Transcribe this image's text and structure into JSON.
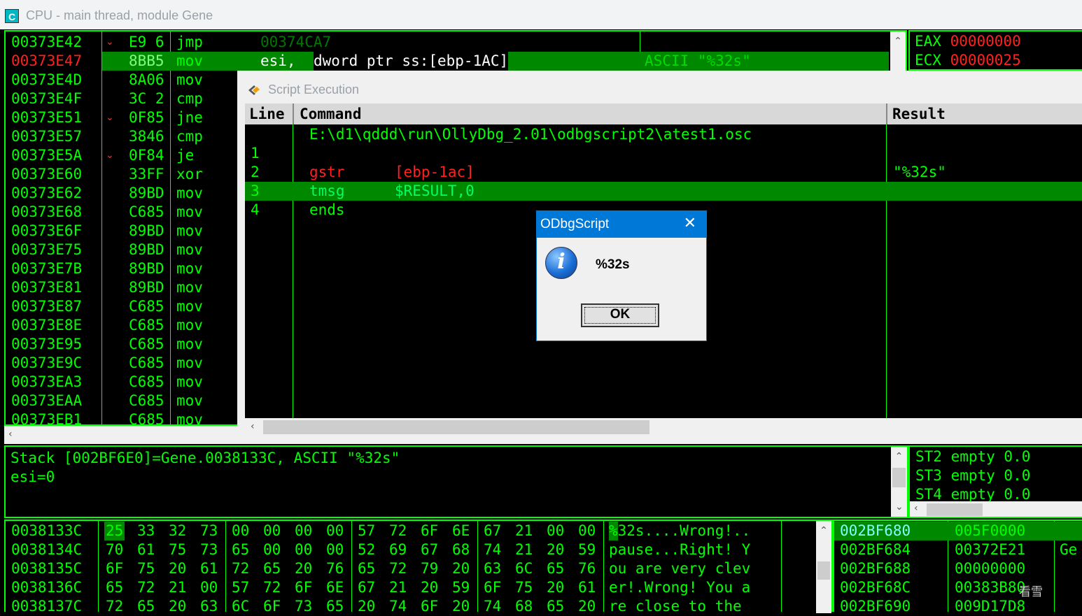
{
  "window": {
    "title": "CPU - main thread, module Gene",
    "logo": "C"
  },
  "disasm": {
    "rows": [
      {
        "addr": "00373E42",
        "hex": "E9 6",
        "mn": "jmp",
        "arrow": "⌄"
      },
      {
        "addr": "00373E47",
        "hex": "8BB5",
        "mn": "mov",
        "arrow": "",
        "selected": true
      },
      {
        "addr": "00373E4D",
        "hex": "8A06",
        "mn": "mov",
        "arrow": ""
      },
      {
        "addr": "00373E4F",
        "hex": "3C 2",
        "mn": "cmp",
        "arrow": ""
      },
      {
        "addr": "00373E51",
        "hex": "0F85",
        "mn": "jne",
        "arrow": "⌄"
      },
      {
        "addr": "00373E57",
        "hex": "3846",
        "mn": "cmp",
        "arrow": ""
      },
      {
        "addr": "00373E5A",
        "hex": "0F84",
        "mn": "je",
        "arrow": "⌄"
      },
      {
        "addr": "00373E60",
        "hex": "33FF",
        "mn": "xor",
        "arrow": ""
      },
      {
        "addr": "00373E62",
        "hex": "89BD",
        "mn": "mov",
        "arrow": ""
      },
      {
        "addr": "00373E68",
        "hex": "C685",
        "mn": "mov",
        "arrow": ""
      },
      {
        "addr": "00373E6F",
        "hex": "89BD",
        "mn": "mov",
        "arrow": ""
      },
      {
        "addr": "00373E75",
        "hex": "89BD",
        "mn": "mov",
        "arrow": ""
      },
      {
        "addr": "00373E7B",
        "hex": "89BD",
        "mn": "mov",
        "arrow": ""
      },
      {
        "addr": "00373E81",
        "hex": "89BD",
        "mn": "mov",
        "arrow": ""
      },
      {
        "addr": "00373E87",
        "hex": "C685",
        "mn": "mov",
        "arrow": ""
      },
      {
        "addr": "00373E8E",
        "hex": "C685",
        "mn": "mov",
        "arrow": ""
      },
      {
        "addr": "00373E95",
        "hex": "C685",
        "mn": "mov",
        "arrow": ""
      },
      {
        "addr": "00373E9C",
        "hex": "C685",
        "mn": "mov",
        "arrow": ""
      },
      {
        "addr": "00373EA3",
        "hex": "C685",
        "mn": "mov",
        "arrow": ""
      },
      {
        "addr": "00373EAA",
        "hex": "C685",
        "mn": "mov",
        "arrow": ""
      },
      {
        "addr": "00373EB1",
        "hex": "C685",
        "mn": "mov",
        "arrow": ""
      }
    ],
    "row0_operand": "00374CA7",
    "row1_operand_a": "esi,",
    "row1_operand_b": "dword ptr ss:[ebp-1AC]",
    "row1_comment": "ASCII \"%32s\""
  },
  "registers": [
    {
      "name": "EAX",
      "value": "00000000"
    },
    {
      "name": "ECX",
      "value": "00000025"
    }
  ],
  "script": {
    "title": "Script Execution",
    "headers": {
      "line": "Line",
      "command": "Command",
      "result": "Result"
    },
    "path": "E:\\d1\\qddd\\run\\OllyDbg_2.01\\odbgscript2\\atest1.osc",
    "rows": [
      {
        "line": "1",
        "cmd": "",
        "args": "",
        "result": ""
      },
      {
        "line": "2",
        "cmd": "gstr",
        "args": "[ebp-1ac]",
        "result": "\"%32s\""
      },
      {
        "line": "3",
        "cmd": "tmsg",
        "args": "$RESULT,0",
        "result": "",
        "current": true
      },
      {
        "line": "4",
        "cmd": "ends",
        "args": "",
        "result": ""
      }
    ]
  },
  "msgbox": {
    "title": "ODbgScript",
    "text": "%32s",
    "ok": "OK",
    "close": "✕"
  },
  "info": {
    "line1": "Stack [002BF6E0]=Gene.0038133C, ASCII \"%32s\"",
    "line2": "esi=0"
  },
  "fpu": [
    "ST2 empty 0.0",
    "ST3 empty 0.0",
    "ST4 empty 0.0"
  ],
  "dump": {
    "rows": [
      {
        "addr": "0038133C",
        "b": [
          "25",
          "33",
          "32",
          "73",
          "00",
          "00",
          "00",
          "00",
          "57",
          "72",
          "6F",
          "6E",
          "67",
          "21",
          "00",
          "00"
        ],
        "ascii": "%32s....Wrong!.."
      },
      {
        "addr": "0038134C",
        "b": [
          "70",
          "61",
          "75",
          "73",
          "65",
          "00",
          "00",
          "00",
          "52",
          "69",
          "67",
          "68",
          "74",
          "21",
          "20",
          "59"
        ],
        "ascii": "pause...Right! Y"
      },
      {
        "addr": "0038135C",
        "b": [
          "6F",
          "75",
          "20",
          "61",
          "72",
          "65",
          "20",
          "76",
          "65",
          "72",
          "79",
          "20",
          "63",
          "6C",
          "65",
          "76"
        ],
        "ascii": "ou are very clev"
      },
      {
        "addr": "0038136C",
        "b": [
          "65",
          "72",
          "21",
          "00",
          "57",
          "72",
          "6F",
          "6E",
          "67",
          "21",
          "20",
          "59",
          "6F",
          "75",
          "20",
          "61"
        ],
        "ascii": "er!.Wrong! You a"
      },
      {
        "addr": "0038137C",
        "b": [
          "72",
          "65",
          "20",
          "63",
          "6C",
          "6F",
          "73",
          "65",
          "20",
          "74",
          "6F",
          "20",
          "74",
          "68",
          "65",
          "20"
        ],
        "ascii": "re close to the "
      }
    ]
  },
  "stack": {
    "rows": [
      {
        "addr": "002BF680",
        "val": "005F0000",
        "cmt": ""
      },
      {
        "addr": "002BF684",
        "val": "00372E21",
        "cmt": "Ge"
      },
      {
        "addr": "002BF688",
        "val": "00000000",
        "cmt": ""
      },
      {
        "addr": "002BF68C",
        "val": "00383B80",
        "cmt": ""
      },
      {
        "addr": "002BF690",
        "val": "009D17D8",
        "cmt": ""
      }
    ]
  },
  "watermark": "看雪",
  "colors": {
    "green": "#00ff00",
    "red": "#ff2020",
    "highlight": "#008800",
    "titlebar": "#0078d7"
  }
}
